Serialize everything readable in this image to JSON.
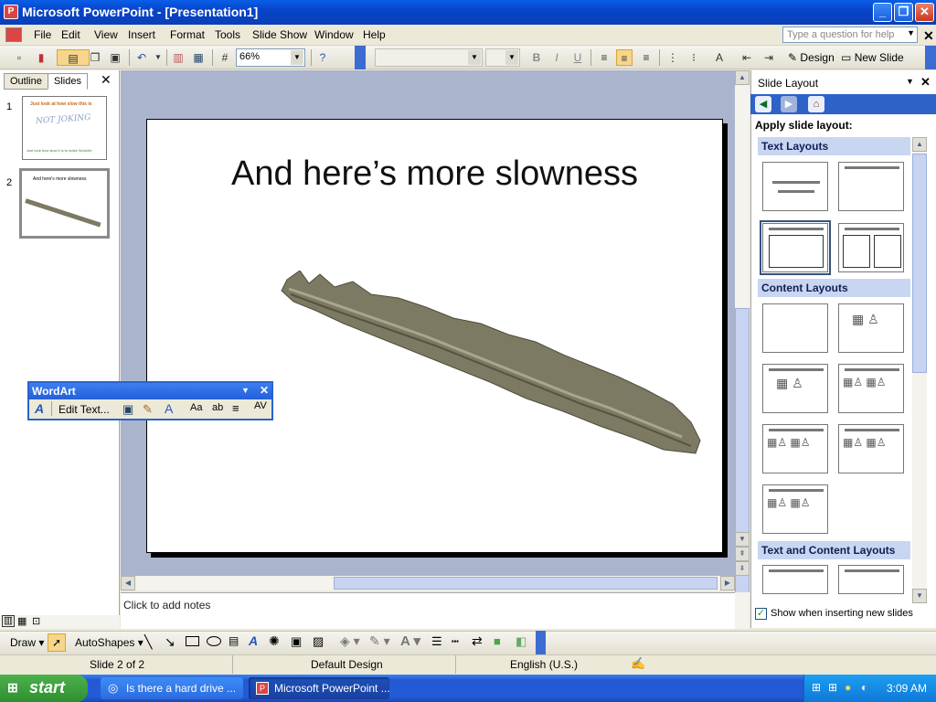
{
  "window": {
    "title": "Microsoft PowerPoint - [Presentation1]",
    "app_icon_letter": "P"
  },
  "window_buttons": {
    "minimize": "_",
    "restore": "❐",
    "close": "✕"
  },
  "menu": [
    "File",
    "Edit",
    "View",
    "Insert",
    "Format",
    "Tools",
    "Slide Show",
    "Window",
    "Help"
  ],
  "help_box": {
    "placeholder": "Type a question for help"
  },
  "toolbar": {
    "zoom": "66%",
    "design_label": "Design",
    "new_slide_label": "New Slide"
  },
  "left_pane": {
    "tabs": [
      "Outline",
      "Slides"
    ],
    "active_tab": "Slides",
    "slides": [
      {
        "number": "1",
        "lines": [
          "Just look at how slow this is",
          "NOT JOKING",
          "Just look how slow it is to make WordArt"
        ]
      },
      {
        "number": "2",
        "lines": [
          "And here's more slowness"
        ]
      }
    ]
  },
  "slide": {
    "title": "And here’s more slowness"
  },
  "notes": {
    "placeholder": "Click to add notes"
  },
  "task_pane": {
    "title": "Slide Layout",
    "apply_label": "Apply slide layout:",
    "sections": [
      "Text Layouts",
      "Content Layouts",
      "Text and Content Layouts"
    ],
    "show_when_inserting": "Show when inserting new slides",
    "show_checked": true
  },
  "wordart_toolbar": {
    "title": "WordArt",
    "edit_text": "Edit Text..."
  },
  "draw_toolbar": {
    "draw": "Draw",
    "autoshapes": "AutoShapes"
  },
  "status": {
    "slide": "Slide 2 of 2",
    "design": "Default Design",
    "language": "English (U.S.)"
  },
  "taskbar": {
    "start": "start",
    "buttons": [
      "Is there a hard drive ...",
      "Microsoft PowerPoint ..."
    ],
    "clock": "3:09 AM"
  },
  "colors": {
    "titlebar": "#0a5ee8",
    "slide_area": "#aab4cd",
    "wordart_3d": "#7d7a63",
    "accent_section": "#c9d6f2"
  }
}
